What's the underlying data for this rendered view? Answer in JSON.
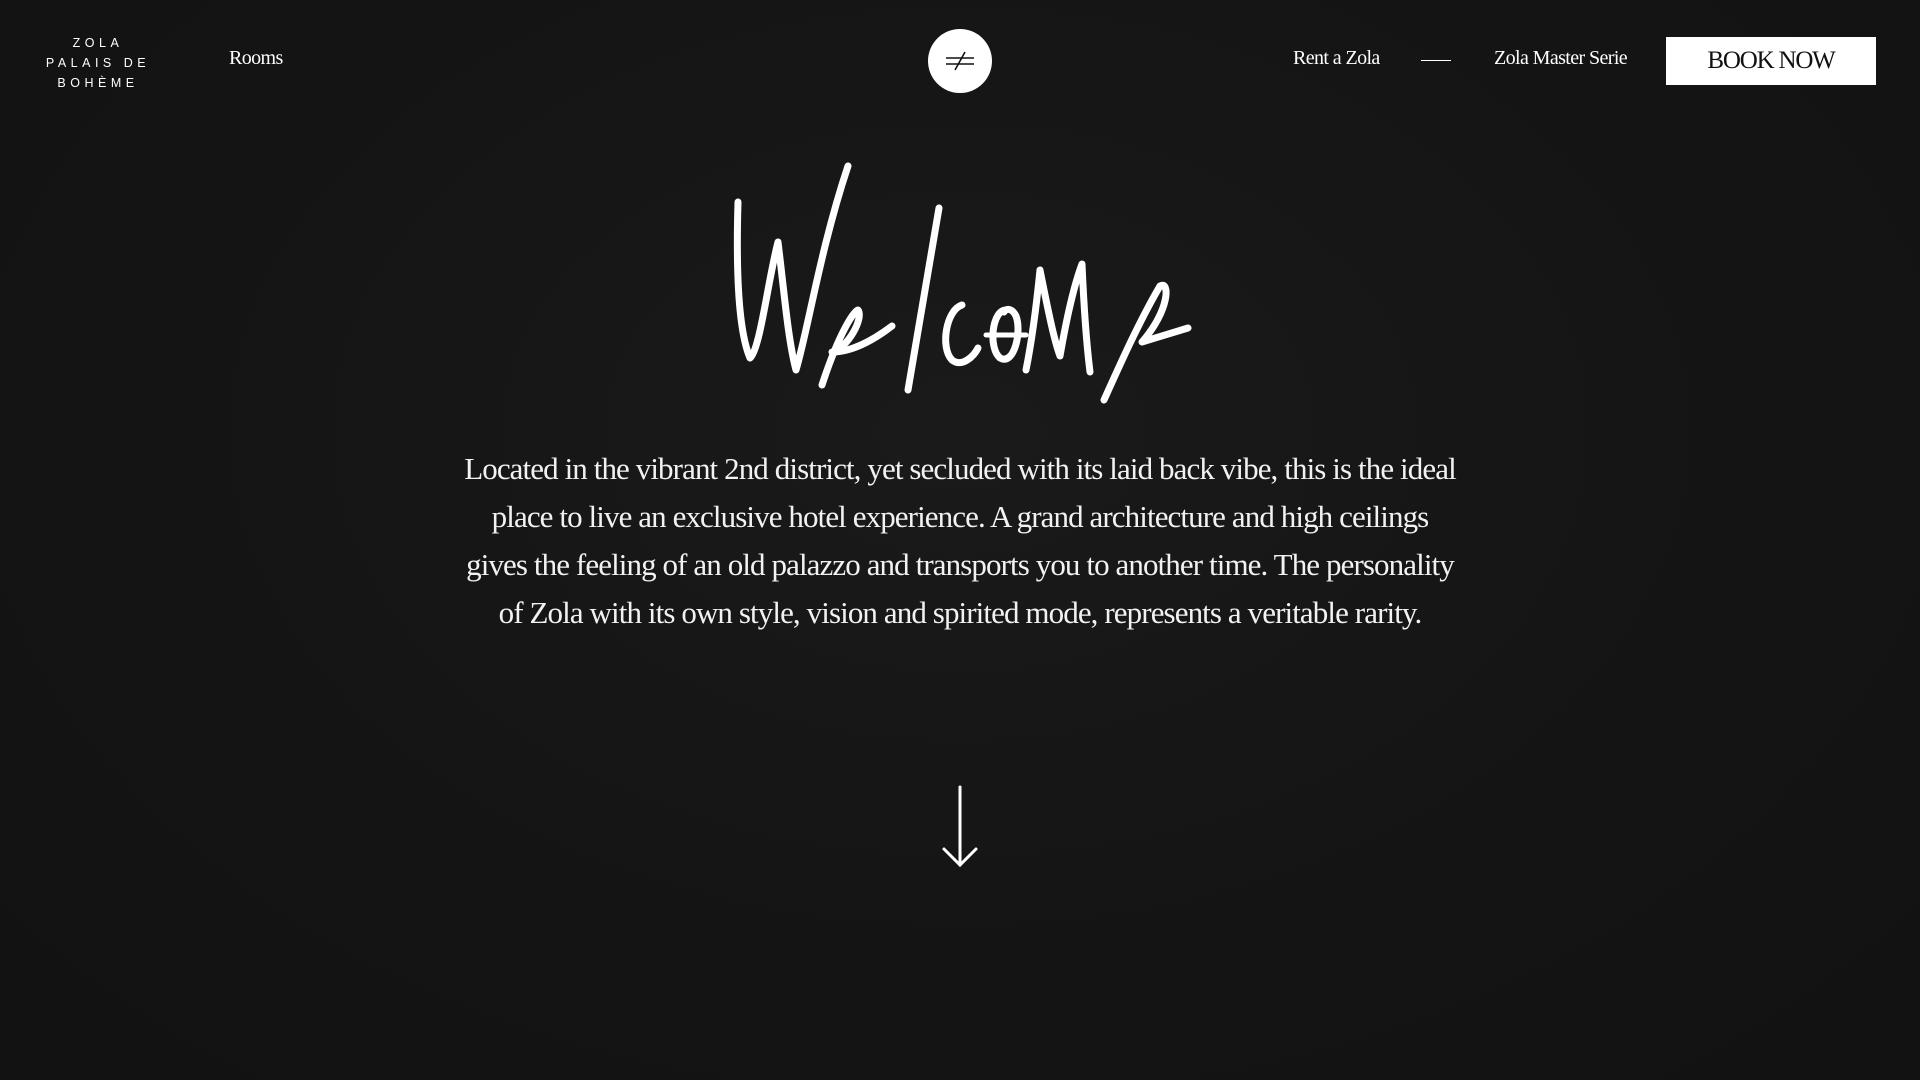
{
  "header": {
    "logo_lines": [
      "ZOLA",
      "PALAIS DE",
      "BOHÈME"
    ],
    "nav_left": {
      "rooms_label": "Rooms"
    },
    "nav_right": {
      "rent_label": "Rent a Zola",
      "master_label": "Zola Master Serie",
      "book_label": "BOOK NOW"
    },
    "menu_icon": "not-equal-icon"
  },
  "hero": {
    "script_heading": "Welcome",
    "intro_text": "Located in the vibrant 2nd district, yet secluded with its laid back vibe, this is the ideal place to live an exclusive hotel experience. A grand architecture and high ceilings gives the feeling of an old palazzo and transports you to another time. The personality of Zola with its own style, vision and spirited mode, represents a veritable rarity.",
    "scroll_icon": "arrow-down-icon"
  },
  "colors": {
    "background": "#151515",
    "text": "#ffffff",
    "button_bg": "#ffffff",
    "button_text": "#111111"
  }
}
